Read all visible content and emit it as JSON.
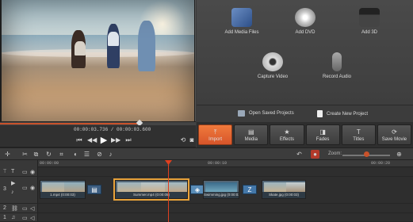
{
  "preview": {
    "timecode": "00:00:03.736 / 00:00:03.600",
    "progress": 0.72
  },
  "transport": {
    "buttons": [
      "skip-back-icon",
      "step-back-icon",
      "play-icon",
      "step-forward-icon",
      "skip-forward-icon"
    ]
  },
  "add_panel": {
    "items": [
      {
        "label": "Add Media Files",
        "icon": "film-icon"
      },
      {
        "label": "Add DVD",
        "icon": "dvd-icon"
      },
      {
        "label": "Add 3D",
        "icon": "clapboard-icon"
      },
      {
        "label": "Capture Video",
        "icon": "webcam-icon"
      },
      {
        "label": "Record Audio",
        "icon": "microphone-icon"
      }
    ],
    "open_project": "Open Saved Projects",
    "new_project": "Create New Project"
  },
  "tabs": [
    {
      "label": "Import",
      "glyph": "⤒",
      "active": true
    },
    {
      "label": "Media",
      "glyph": "▤",
      "active": false
    },
    {
      "label": "Effects",
      "glyph": "★",
      "active": false
    },
    {
      "label": "Fades",
      "glyph": "◨",
      "active": false
    },
    {
      "label": "Titles",
      "glyph": "T",
      "active": false
    },
    {
      "label": "Save Movie",
      "glyph": "⟳",
      "active": false
    }
  ],
  "edit_toolbar": {
    "zoom_label": "Zoom:",
    "zoom_level": 0.5
  },
  "timeline": {
    "ruler": [
      "00:00:00",
      "00:00:10",
      "00:00:20"
    ],
    "track_heads": [
      "T",
      "3",
      "2",
      "1"
    ],
    "clips": [
      {
        "name": "1.mp4 (0:00:03)"
      },
      {
        "name": "Summer.mp4 (0:00:05)"
      },
      {
        "name": "Swimming.jpg (0:00:03)"
      },
      {
        "name": "Skate.jpg (0:00:03)"
      }
    ],
    "transition_glyph": "Z"
  },
  "colors": {
    "accent": "#e8652f",
    "playhead": "#e04020",
    "selection": "#e8a23a"
  }
}
